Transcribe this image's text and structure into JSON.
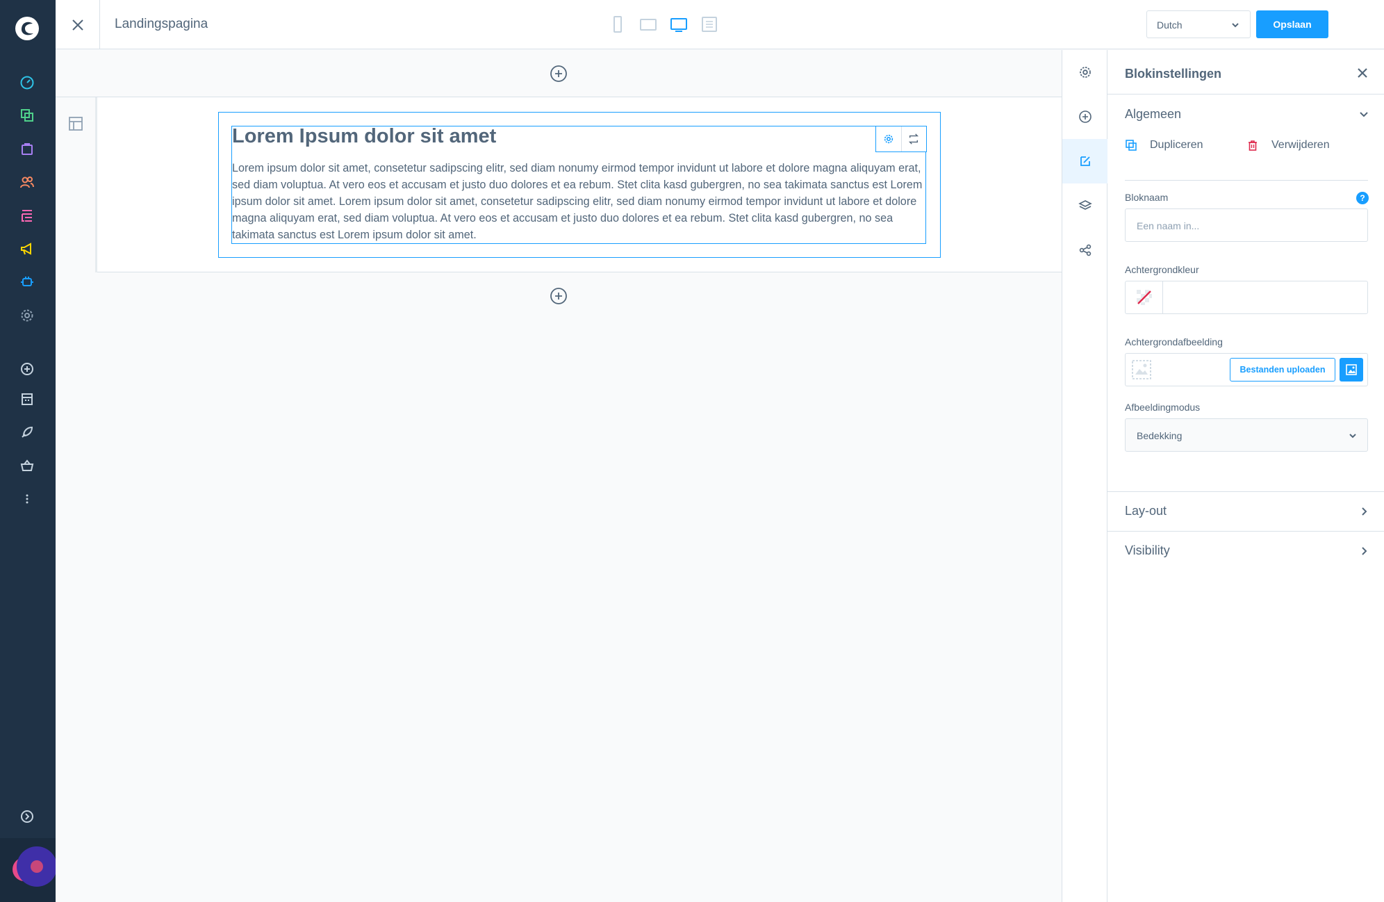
{
  "header": {
    "page_name": "Landingspagina",
    "language": "Dutch",
    "save_label": "Opslaan"
  },
  "colors": {
    "sidebar_bg": "#1f3246",
    "accent": "#189eff",
    "text": "#52667a"
  },
  "sidebar_icons": [
    "logo-icon",
    "dashboard-icon",
    "catalogues-icon",
    "orders-icon",
    "customers-icon",
    "content-icon",
    "marketing-icon",
    "extensions-icon",
    "settings-icon",
    "add-icon",
    "sales-channel-icon",
    "rocket-icon",
    "store-icon",
    "more-icon",
    "expand-icon"
  ],
  "block": {
    "title": "Lorem Ipsum dolor sit amet",
    "text": "Lorem ipsum dolor sit amet, consetetur sadipscing elitr, sed diam nonumy eirmod tempor invidunt ut labore et dolore magna aliquyam erat, sed diam voluptua. At vero eos et accusam et justo duo dolores et ea rebum. Stet clita kasd gubergren, no sea takimata sanctus est Lorem ipsum dolor sit amet. Lorem ipsum dolor sit amet, consetetur sadipscing elitr, sed diam nonumy eirmod tempor invidunt ut labore et dolore magna aliquyam erat, sed diam voluptua. At vero eos et accusam et justo duo dolores et ea rebum. Stet clita kasd gubergren, no sea takimata sanctus est Lorem ipsum dolor sit amet."
  },
  "panel": {
    "title": "Blokinstellingen",
    "general": {
      "label": "Algemeen",
      "duplicate_label": "Dupliceren",
      "delete_label": "Verwijderen",
      "block_name_label": "Bloknaam",
      "block_name_placeholder": "Een naam in...",
      "help_glyph": "?",
      "bg_color_label": "Achtergrondkleur",
      "bg_image_label": "Achtergrondafbeelding",
      "upload_label": "Bestanden uploaden",
      "image_mode_label": "Afbeeldingmodus",
      "image_mode_value": "Bedekking"
    },
    "layout_label": "Lay-out",
    "visibility_label": "Visibility"
  }
}
